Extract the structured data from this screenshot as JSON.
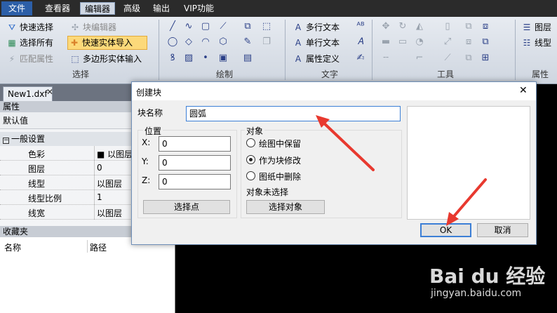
{
  "menubar": {
    "items": [
      "文件",
      "查看器",
      "编辑器",
      "高级",
      "输出",
      "VIP功能"
    ],
    "active": "编辑器"
  },
  "ribbon": {
    "select_group": {
      "title": "选择",
      "buttons": [
        {
          "label": "快速选择",
          "icon": "funnel-icon"
        },
        {
          "label": "块编辑器",
          "icon": "block-edit-icon",
          "disabled": true
        },
        {
          "label": "选择所有",
          "icon": "select-all-icon"
        },
        {
          "label": "快速实体导入",
          "icon": "add-entity-icon",
          "highlighted": true
        },
        {
          "label": "匹配属性",
          "icon": "match-props-icon",
          "disabled": true
        },
        {
          "label": "多边形实体输入",
          "icon": "polygon-entity-icon"
        }
      ]
    },
    "draw_group": {
      "title": "绘制"
    },
    "text_group": {
      "title": "文字",
      "buttons": [
        {
          "label": "多行文本",
          "icon": "mtext-icon"
        },
        {
          "label": "单行文本",
          "icon": "text-icon"
        },
        {
          "label": "属性定义",
          "icon": "attdef-icon"
        }
      ]
    },
    "tools_group": {
      "title": "工具"
    },
    "props_group": {
      "title": "属性",
      "buttons": [
        {
          "label": "图层",
          "icon": "layers-icon"
        },
        {
          "label": "线型",
          "icon": "linetype-icon"
        }
      ]
    }
  },
  "doc_tab": {
    "label": "New1.dxf",
    "close": "✕"
  },
  "properties_panel": {
    "title": "属性",
    "default_label": "默认值",
    "section": "一般设置",
    "rows": [
      {
        "key": "色彩",
        "value": "■ 以图层"
      },
      {
        "key": "图层",
        "value": "0"
      },
      {
        "key": "线型",
        "value": "以图层"
      },
      {
        "key": "线型比例",
        "value": "1"
      },
      {
        "key": "线宽",
        "value": "以图层"
      }
    ]
  },
  "favorites_panel": {
    "title": "收藏夹",
    "columns": [
      "名称",
      "路径"
    ]
  },
  "dialog": {
    "title": "创建块",
    "close": "✕",
    "block_name_label": "块名称",
    "block_name_value": "圆弧",
    "position_label": "位置",
    "x_label": "X:",
    "x_value": "0",
    "y_label": "Y:",
    "y_value": "0",
    "z_label": "Z:",
    "z_value": "0",
    "pick_point": "选择点",
    "objects_label": "对象",
    "radio_options": [
      {
        "label": "绘图中保留",
        "selected": false
      },
      {
        "label": "作为块修改",
        "selected": true
      },
      {
        "label": "图纸中删除",
        "selected": false
      }
    ],
    "no_selection": "对象未选择",
    "select_objects": "选择对象",
    "ok": "OK",
    "cancel": "取消"
  },
  "watermark": {
    "brand": "Bai du 经验",
    "url": "jingyan.baidu.com"
  },
  "colors": {
    "annotation_arrow": "#e8392f",
    "menubar": "#2b2b2b",
    "file_tab": "#2c5fa8"
  }
}
